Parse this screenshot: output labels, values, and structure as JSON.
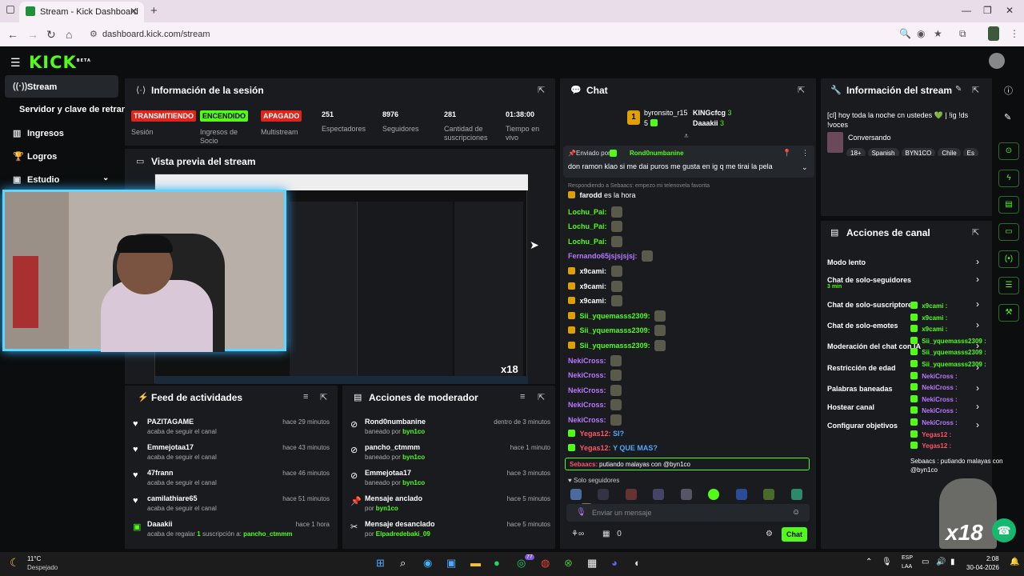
{
  "browser": {
    "tab_title": "Stream - Kick Dashboard",
    "url": "dashboard.kick.com/stream"
  },
  "app": {
    "logo": "KICK",
    "logo_tag": "BETA"
  },
  "sidebar": {
    "items": [
      {
        "label": "Stream",
        "icon": "broadcast-icon"
      },
      {
        "label": "Servidor y clave de retransmisión"
      },
      {
        "label": "Ingresos",
        "icon": "bank-icon"
      },
      {
        "label": "Logros",
        "icon": "trophy-icon"
      },
      {
        "label": "Estudio",
        "icon": "studio-icon"
      }
    ]
  },
  "session": {
    "title": "Información de la sesión",
    "stats": [
      {
        "value": "TRANSMITIENDO",
        "label": "Sesión",
        "color": "#e2231a"
      },
      {
        "value": "ENCENDIDO",
        "label": "Ingresos de Socio",
        "color": "#53fc18"
      },
      {
        "value": "APAGADO",
        "label": "Multistream",
        "color": "#e2231a"
      },
      {
        "value": "251",
        "label": "Espectadores"
      },
      {
        "value": "8976",
        "label": "Seguidores"
      },
      {
        "value": "281",
        "label": "Cantidad de suscripciones"
      },
      {
        "value": "01:38:00",
        "label": "Tiempo en vivo"
      }
    ]
  },
  "preview": {
    "title": "Vista previa del stream",
    "overlay": "x18"
  },
  "feed": {
    "title": "Feed de actividades",
    "rows": [
      {
        "name": "PAZITAGAME",
        "sub": "acaba de seguir el canal",
        "time": "hace 29 minutos"
      },
      {
        "name": "Emmejotaa17",
        "sub": "acaba de seguir el canal",
        "time": "hace 43 minutos"
      },
      {
        "name": "47frann",
        "sub": "acaba de seguir el canal",
        "time": "hace 46 minutos"
      },
      {
        "name": "camilathiare65",
        "sub": "acaba de seguir el canal",
        "time": "hace 51 minutos"
      },
      {
        "name": "Daaakii",
        "sub": "acaba de regalar",
        "count": "1",
        "sub2": "suscripción a:",
        "target": "pancho_ctmmm",
        "time": "hace 1 hora"
      }
    ]
  },
  "mod": {
    "title": "Acciones de moderador",
    "rows": [
      {
        "name": "Rond0numbanine",
        "sub": "baneado por",
        "by": "byn1co",
        "time": "dentro de 3 minutos"
      },
      {
        "name": "pancho_ctmmm",
        "sub": "baneado por",
        "by": "byn1co",
        "time": "hace 1 minuto"
      },
      {
        "name": "Emmejotaa17",
        "sub": "baneado por",
        "by": "byn1co",
        "time": "hace 3 minutos"
      },
      {
        "name": "Mensaje anclado",
        "sub": "por",
        "by": "byn1co",
        "time": "hace 5 minutos"
      },
      {
        "name": "Mensaje desanclado",
        "sub": "por",
        "by": "Elpadredebaki_09",
        "time": "hace 5 minutos"
      }
    ]
  },
  "chat": {
    "title": "Chat",
    "top": [
      {
        "rank": "1",
        "name": "byronsito_r15",
        "count": "5"
      },
      {
        "name": "KINGcfcg",
        "count": "3"
      },
      {
        "name": "Daaakii",
        "count": "3"
      }
    ],
    "pinned_by_label": "Enviado por",
    "pinned_by": "Rond0numbanine",
    "pinned_text": "don ramon klao si me dai puros me gusta en ig q me tirai la pela",
    "reply_note": "Respondiendo a Sebaacs: empezo mi telenovela favorita",
    "messages": [
      {
        "user": "farodd",
        "text": "es la hora",
        "cls": "un-w"
      },
      {
        "user": "Lochu_Pai:",
        "cls": "un-g"
      },
      {
        "user": "Lochu_Pai:",
        "cls": "un-g"
      },
      {
        "user": "Lochu_Pai:",
        "cls": "un-g"
      },
      {
        "user": "Fernando65jsjsjsjsj:",
        "cls": "un-p"
      },
      {
        "user": "x9cami:",
        "cls": "un-w"
      },
      {
        "user": "x9cami:",
        "cls": "un-w"
      },
      {
        "user": "x9cami:",
        "cls": "un-w"
      },
      {
        "user": "Sii_yquemasss2309:",
        "cls": "un-g"
      },
      {
        "user": "Sii_yquemasss2309:",
        "cls": "un-g"
      },
      {
        "user": "Sii_yquemasss2309:",
        "cls": "un-g"
      },
      {
        "user": "NekiCross:",
        "cls": "un-p"
      },
      {
        "user": "NekiCross:",
        "cls": "un-p"
      },
      {
        "user": "NekiCross:",
        "cls": "un-p"
      },
      {
        "user": "NekiCross:",
        "cls": "un-p"
      },
      {
        "user": "NekiCross:",
        "cls": "un-p"
      },
      {
        "user": "Yegas12:",
        "text": "SI?",
        "cls": "un-r"
      },
      {
        "user": "Yegas12:",
        "text": "Y QUE MAS?",
        "cls": "un-r"
      }
    ],
    "highlight_user": "Sebaacs:",
    "highlight_text": "putiando malayas con @byn1co",
    "followers_only": "Solo seguidores",
    "input_placeholder": "Enviar un mensaje",
    "viewers_icon_count": "0",
    "send_label": "Chat"
  },
  "stream_info": {
    "title": "Información del stream",
    "stream_title": "[cl] hoy toda la noche cn ustedes 💚 | !ig !ds !voces",
    "category": "Conversando",
    "tags": [
      "18+",
      "Spanish",
      "BYN1CO",
      "Chile",
      "Es"
    ]
  },
  "channel_actions": {
    "title": "Acciones de canal",
    "items": [
      {
        "label": "Modo lento"
      },
      {
        "label": "Chat de solo-seguidores",
        "sub": "3 min"
      },
      {
        "label": "Chat de solo-suscriptores"
      },
      {
        "label": "Chat de solo-emotes"
      },
      {
        "label": "Moderación del chat con IA"
      },
      {
        "label": "Restricción de edad"
      },
      {
        "label": "Palabras baneadas"
      },
      {
        "label": "Hostear canal"
      },
      {
        "label": "Configurar objetivos"
      }
    ]
  },
  "overlay_chat": [
    "x9cami :",
    "x9cami :",
    "x9cami :",
    "Sii_yquemasss2309 :",
    "Sii_yquemasss2309 :",
    "Sii_yquemasss2309 :",
    "NekiCross :",
    "NekiCross :",
    "NekiCross :",
    "NekiCross :",
    "NekiCross :",
    "Yegas12 :",
    "Yegas12 :"
  ],
  "overlay_last": "Sebaacs : putiando malayas con @byn1co",
  "taskbar": {
    "weather_temp": "11°C",
    "weather_desc": "Despejado",
    "lang": "ESP",
    "lang2": "LAA",
    "time": "2:08",
    "date": "30-04-2026",
    "badge": "77"
  }
}
